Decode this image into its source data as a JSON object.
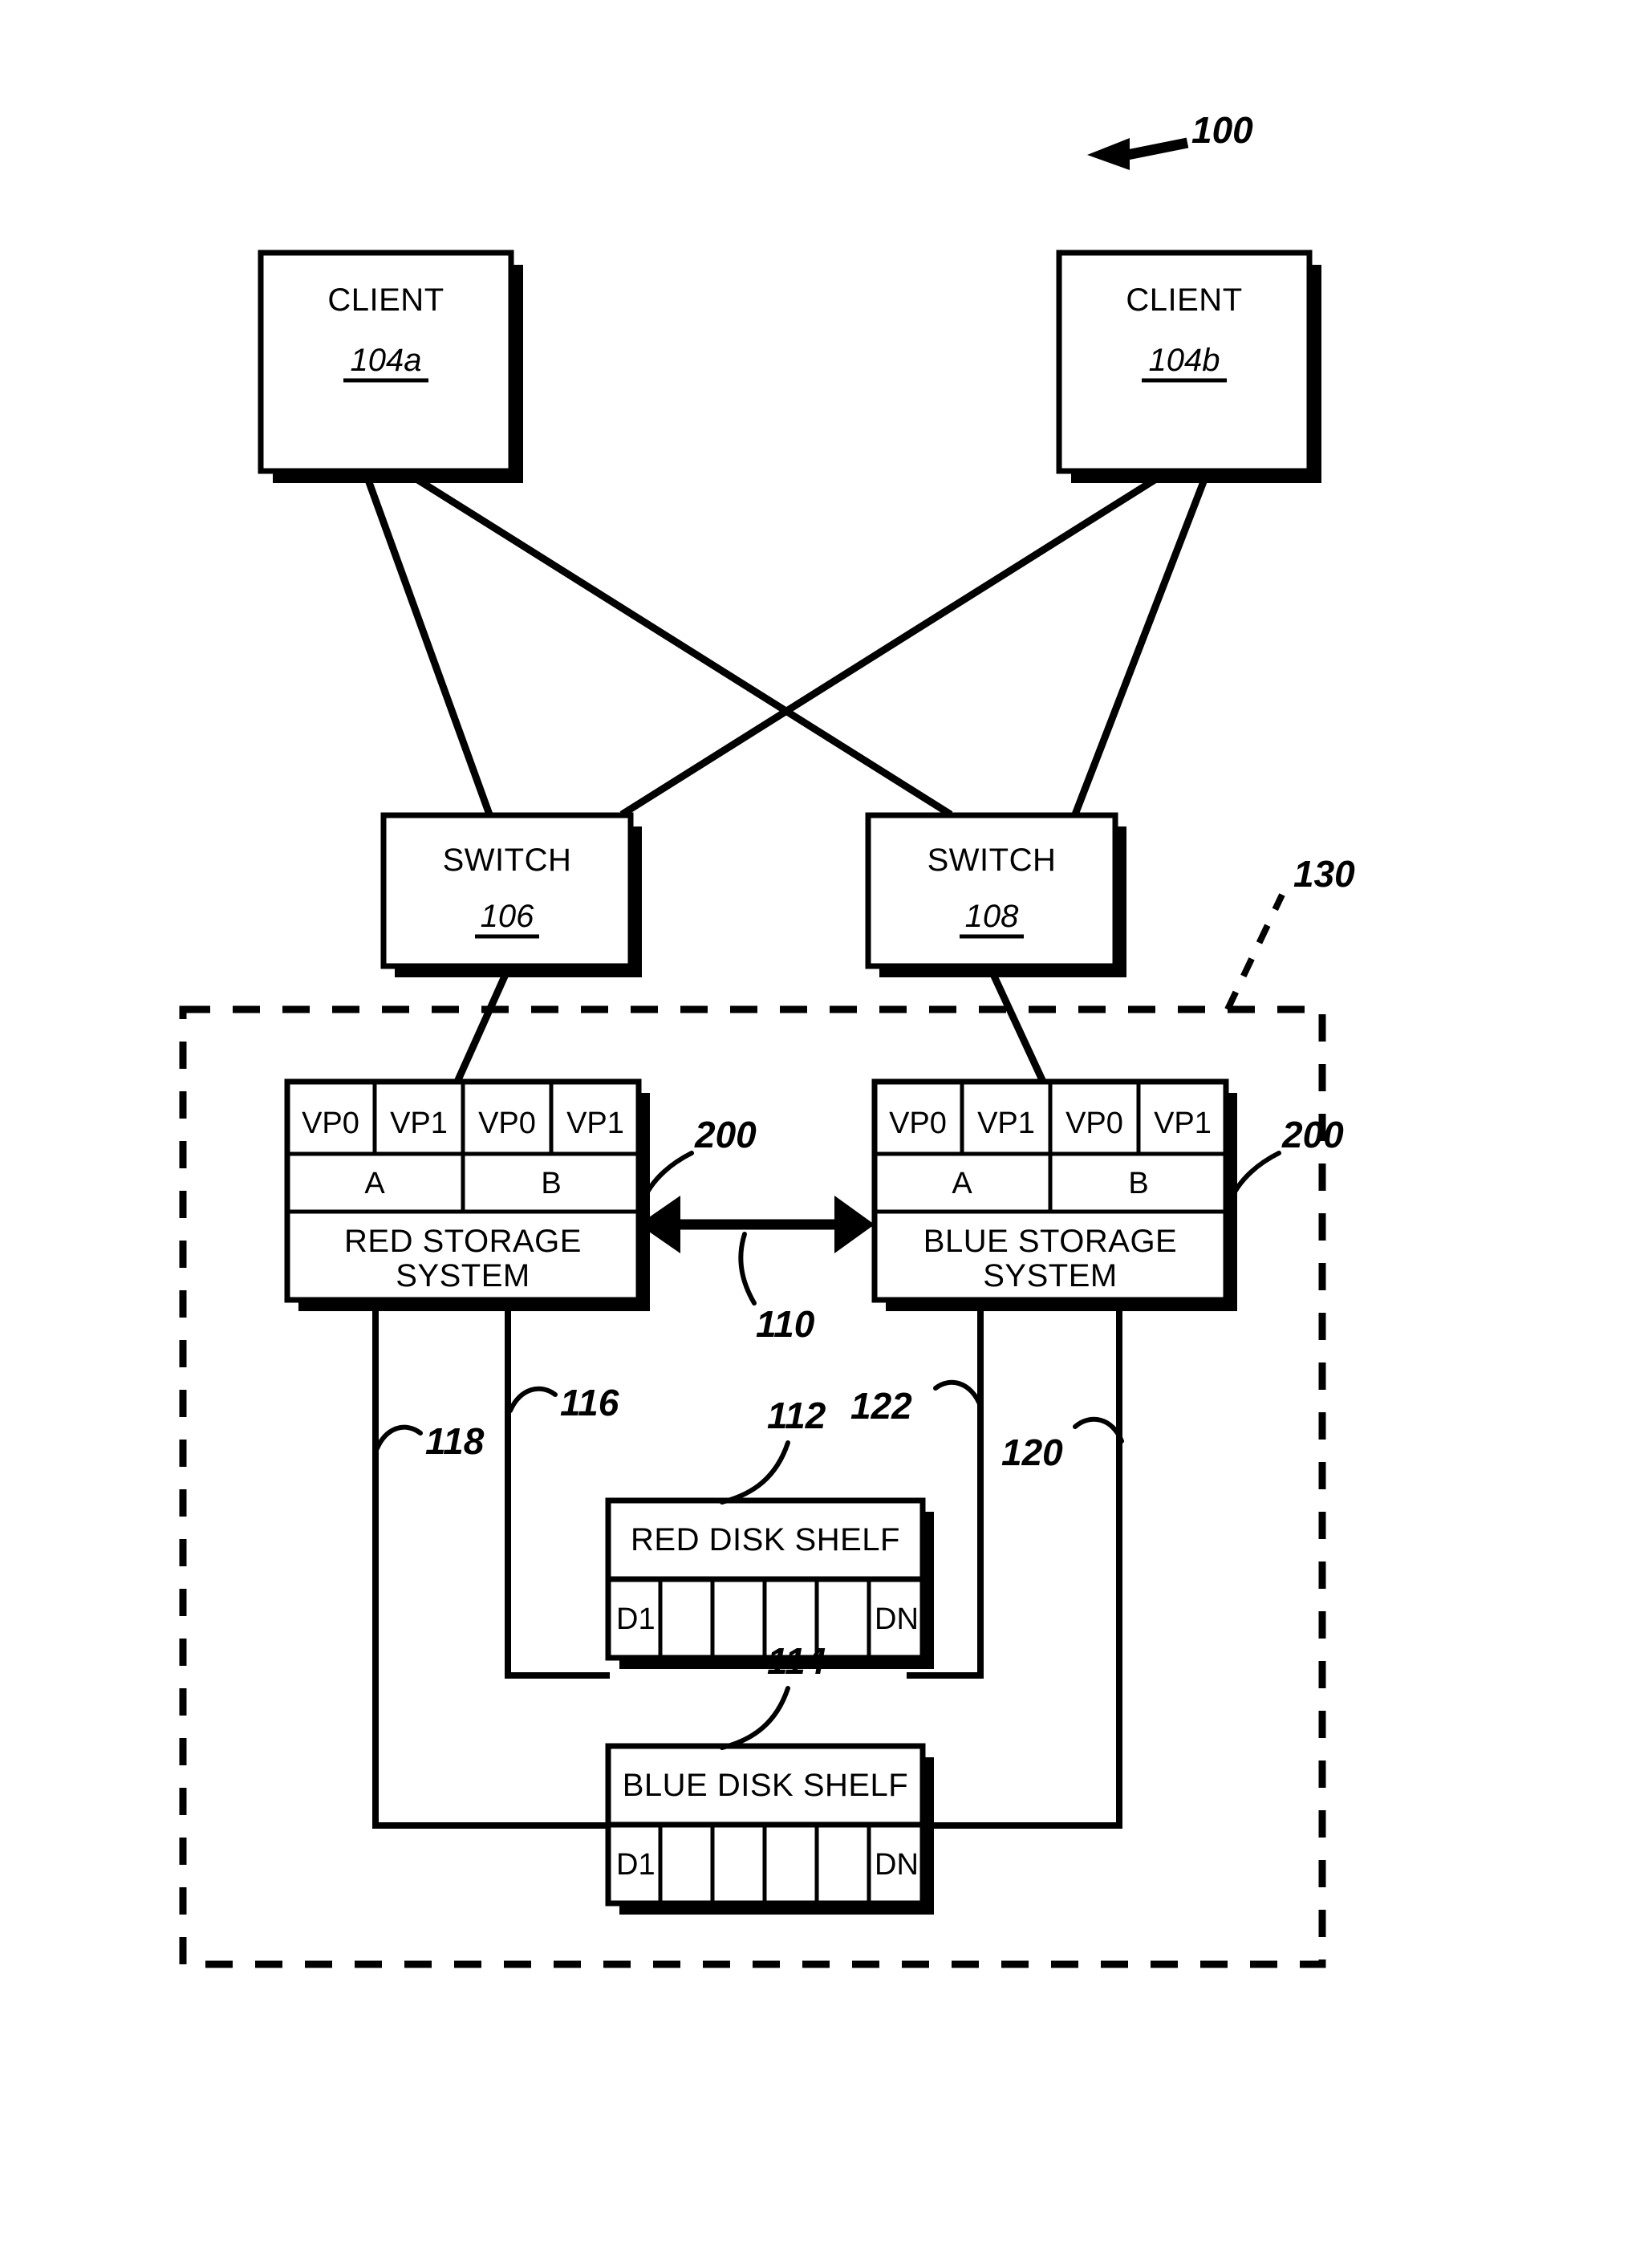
{
  "figure": {
    "figure_ref": "100",
    "enclosure_ref": "130",
    "interconnect_ref": "110"
  },
  "clients": [
    {
      "title": "CLIENT",
      "ref": "104a"
    },
    {
      "title": "CLIENT",
      "ref": "104b"
    }
  ],
  "switches": [
    {
      "title": "SWITCH",
      "ref": "106"
    },
    {
      "title": "SWITCH",
      "ref": "108"
    }
  ],
  "storage_systems": [
    {
      "name": "RED STORAGE SYSTEM",
      "name_line1": "RED STORAGE",
      "name_line2": "SYSTEM",
      "ref": "200",
      "vports": [
        "VP0",
        "VP1",
        "VP0",
        "VP1"
      ],
      "nodes": [
        "A",
        "B"
      ]
    },
    {
      "name": "BLUE STORAGE SYSTEM",
      "name_line1": "BLUE STORAGE",
      "name_line2": "SYSTEM",
      "ref": "200",
      "vports": [
        "VP0",
        "VP1",
        "VP0",
        "VP1"
      ],
      "nodes": [
        "A",
        "B"
      ]
    }
  ],
  "disk_shelves": [
    {
      "name": "RED DISK SHELF",
      "ref": "112",
      "disks": [
        "D1",
        "",
        "",
        "",
        "",
        "DN"
      ]
    },
    {
      "name": "BLUE DISK SHELF",
      "ref": "114",
      "disks": [
        "D1",
        "",
        "",
        "",
        "",
        "DN"
      ]
    }
  ],
  "connection_refs": {
    "red_to_blue_shelf": "118",
    "red_to_red_shelf": "116",
    "blue_to_red_shelf": "122",
    "blue_to_blue_shelf": "120"
  }
}
